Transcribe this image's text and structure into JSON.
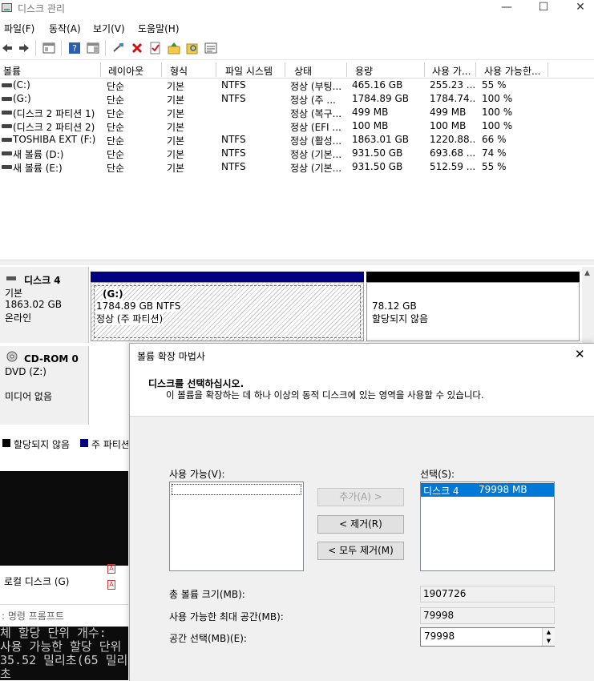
{
  "window": {
    "title": "디스크 관리",
    "min_glyph": "—",
    "max_glyph": "☐",
    "close_glyph": "✕"
  },
  "menu": [
    "파일(F)",
    "동작(A)",
    "보기(V)",
    "도움말(H)"
  ],
  "toolbar": {
    "icons": [
      "back-icon",
      "forward-icon",
      "console-tree-icon",
      "help-icon",
      "properties-pane-icon",
      "connect-icon",
      "delete-icon",
      "check-icon",
      "import-icon",
      "search-icon",
      "list-icon"
    ]
  },
  "volume_table": {
    "columns": [
      "볼륨",
      "레이아웃",
      "형식",
      "파일 시스템",
      "상태",
      "용량",
      "사용 가...",
      "사용 가능한..."
    ],
    "rows": [
      [
        "(C:)",
        "단순",
        "기본",
        "NTFS",
        "정상 (부팅...",
        "465.16 GB",
        "255.23 ...",
        "55 %"
      ],
      [
        "(G:)",
        "단순",
        "기본",
        "NTFS",
        "정상 (주 ...",
        "1784.89 GB",
        "1784.74...",
        "100 %"
      ],
      [
        "(디스크 2 파티션 1)",
        "단순",
        "기본",
        "",
        "정상 (복구...",
        "499 MB",
        "499 MB",
        "100 %"
      ],
      [
        "(디스크 2 파티션 2)",
        "단순",
        "기본",
        "",
        "정상 (EFI ...",
        "100 MB",
        "100 MB",
        "100 %"
      ],
      [
        "TOSHIBA EXT (F:)",
        "단순",
        "기본",
        "NTFS",
        "정상 (활성...",
        "1863.01 GB",
        "1220.88...",
        "66 %"
      ],
      [
        "새 볼륨 (D:)",
        "단순",
        "기본",
        "NTFS",
        "정상 (기본...",
        "931.50 GB",
        "693.68 ...",
        "74 %"
      ],
      [
        "새 볼륨 (E:)",
        "단순",
        "기본",
        "NTFS",
        "정상 (기본...",
        "931.50 GB",
        "512.59 ...",
        "55 %"
      ]
    ]
  },
  "disk4": {
    "name": "디스크 4",
    "type": "기본",
    "size": "1863.02 GB",
    "state": "온라인",
    "partitions": [
      {
        "label": "(G:)",
        "size": "1784.89 GB NTFS",
        "status": "정상 (주 파티션)"
      },
      {
        "size": "78.12 GB",
        "status": "할당되지 않음"
      }
    ]
  },
  "cdrom0": {
    "name": "CD-ROM 0",
    "type": "DVD (Z:)",
    "state": "미디어 없음"
  },
  "legend": {
    "unallocated": "할당되지 않음",
    "primary": "주 파티션"
  },
  "colors": {
    "primary_partition": "#000080",
    "unallocated": "#000000",
    "selection": "#0078d7"
  },
  "background_items": {
    "local_disk": "로컬 디스크 (G)",
    "cmd_title": ": 명령 프롬프트",
    "console_lines": [
      "체 할당 단위 개수:",
      "사용 가능한 할당 단위",
      "35.52 밀리초(65 밀리초"
    ]
  },
  "wizard": {
    "title": "볼륨 확장 마법사",
    "heading": "디스크를 선택하십시오.",
    "subheading": "이 볼륨을 확장하는 데 하나 이상의 동적 디스크에 있는 영역을 사용할 수 있습니다.",
    "available_label": "사용 가능(V):",
    "selected_label": "선택(S):",
    "selected_items": [
      {
        "disk": "디스크 4",
        "size": "79998 MB"
      }
    ],
    "add_button": "추가(A) >",
    "remove_button": "< 제거(R)",
    "remove_all_button": "< 모두 제거(M)",
    "total_size_label": "총 볼륨 크기(MB):",
    "total_size_value": "1907726",
    "max_space_label": "사용 가능한 최대 공간(MB):",
    "max_space_value": "79998",
    "select_space_label": "공간 선택(MB)(E):",
    "select_space_value": "79998"
  }
}
